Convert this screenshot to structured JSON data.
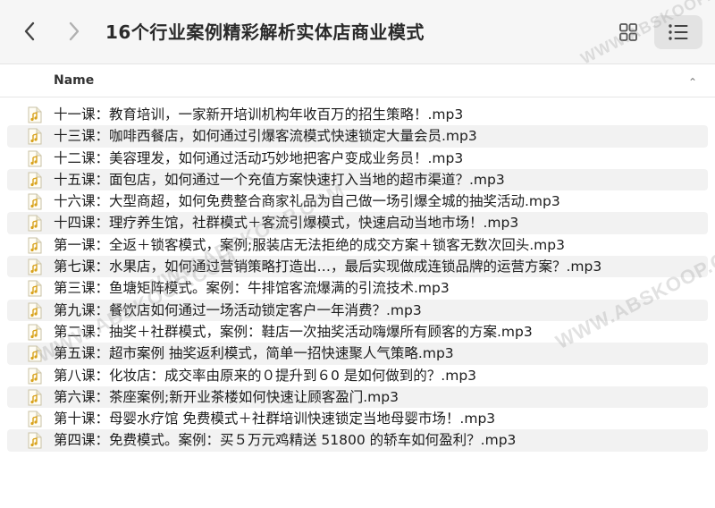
{
  "window": {
    "title": "16个行业案例精彩解析实体店商业模式"
  },
  "toolbar": {
    "back_icon": "chevron-left-icon",
    "forward_icon": "chevron-right-icon",
    "grid_view_icon": "grid-view-icon",
    "list_view_icon": "list-view-icon",
    "active_view": "list"
  },
  "columns": {
    "name": "Name",
    "sort": "ascending"
  },
  "files": [
    "十一课：教育培训，一家新开培训机构年收百万的招生策略！.mp3",
    "十三课：咖啡西餐店，如何通过引爆客流模式快速锁定大量会员.mp3",
    "十二课：美容理发，如何通过活动巧妙地把客户变成业务员！.mp3",
    "十五课：面包店，如何通过一个充值方案快速打入当地的超市渠道？.mp3",
    "十六课：大型商超，如何免费整合商家礼品为自己做一场引爆全城的抽奖活动.mp3",
    "十四课：理疗养生馆，社群模式＋客流引爆模式，快速启动当地市场！.mp3",
    "第一课：全返＋锁客模式，案例;服装店无法拒绝的成交方案＋锁客无数次回头.mp3",
    "第七课：水果店，如何通过营销策略打造出…，最后实现做成连锁品牌的运营方案？.mp3",
    "第三课：鱼塘矩阵模式。案例：牛排馆客流爆满的引流技术.mp3",
    "第九课：餐饮店如何通过一场活动锁定客户一年消费？.mp3",
    "第二课：抽奖＋社群模式，案例：鞋店一次抽奖活动嗨爆所有顾客的方案.mp3",
    "第五课：超市案例 抽奖返利模式，简单一招快速聚人气策略.mp3",
    "第八课：化妆店：成交率由原来的０提升到６0 是如何做到的？.mp3",
    "第六课：茶座案例;新开业茶楼如何快速让顾客盈门.mp3",
    "第十课：母婴水疗馆 免费模式＋社群培训快速锁定当地母婴市场！.mp3",
    "第四课：免费模式。案例：买５万元鸡精送 51800 的轿车如何盈利？.mp3"
  ],
  "file_icon": "audio-file-icon",
  "watermark": "WWW.ABSKOOP.COM",
  "colors": {
    "toolbar_bg": "#f6f6f6",
    "alt_row": "#f2f2f2",
    "selected_view_bg": "#e3e3e3"
  }
}
